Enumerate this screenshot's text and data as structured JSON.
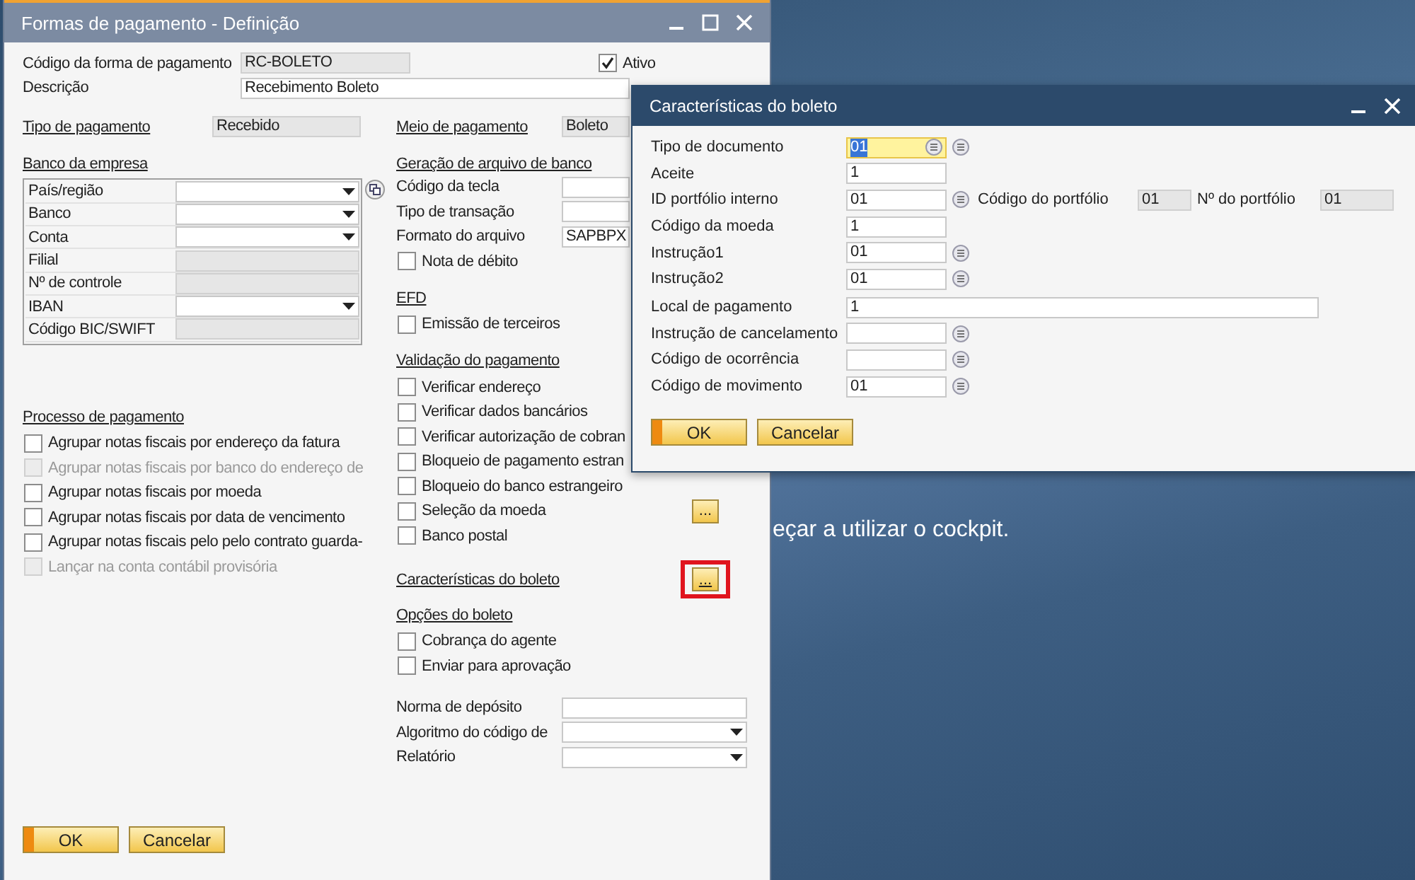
{
  "desktop": {
    "message": "eçar a utilizar o cockpit."
  },
  "main_window": {
    "title": "Formas de pagamento - Definição",
    "code": {
      "label": "Código da forma de pagamento",
      "value": "RC-BOLETO"
    },
    "active": {
      "label": "Ativo",
      "checked": true
    },
    "description": {
      "label": "Descrição",
      "value": "Recebimento Boleto"
    },
    "left": [
      {
        "kind": "readonly",
        "label": "Tipo de pagamento",
        "value": "Recebido",
        "linked": true
      },
      {
        "kind": "title",
        "text": "Banco da empresa"
      },
      {
        "kind": "table",
        "rows": [
          {
            "label": "País/região",
            "kind": "dropdown"
          },
          {
            "label": "Banco",
            "kind": "dropdown"
          },
          {
            "label": "Conta",
            "kind": "dropdown"
          },
          {
            "label": "Filial",
            "kind": "readonly"
          },
          {
            "label": "Nº de controle",
            "kind": "readonly"
          },
          {
            "label": "IBAN",
            "kind": "dropdown"
          },
          {
            "label": "Código BIC/SWIFT",
            "kind": "readonly"
          }
        ]
      },
      {
        "kind": "title",
        "text": "Processo de pagamento"
      },
      {
        "kind": "checkbox",
        "label": "Agrupar notas fiscais por endereço da fatura",
        "checked": false,
        "disabled": false
      },
      {
        "kind": "checkbox",
        "label": "Agrupar notas fiscais por banco do endereço de",
        "checked": false,
        "disabled": true
      },
      {
        "kind": "checkbox",
        "label": "Agrupar notas fiscais por moeda",
        "checked": false,
        "disabled": false
      },
      {
        "kind": "checkbox",
        "label": "Agrupar notas fiscais por data de vencimento",
        "checked": false,
        "disabled": false
      },
      {
        "kind": "checkbox",
        "label": "Agrupar notas fiscais pelo pelo contrato guarda-",
        "checked": false,
        "disabled": false
      },
      {
        "kind": "checkbox",
        "label": "Lançar na conta contábil provisória",
        "checked": false,
        "disabled": true
      }
    ],
    "right": [
      {
        "kind": "readonly",
        "label": "Meio de pagamento",
        "value": "Boleto",
        "linked": true
      },
      {
        "kind": "title",
        "text": "Geração de arquivo de banco"
      },
      {
        "kind": "input",
        "label": "Código da tecla",
        "linked": false
      },
      {
        "kind": "input",
        "label": "Tipo de transação",
        "linked": false
      },
      {
        "kind": "input",
        "label": "Formato do arquivo",
        "value": "SAPBPX",
        "linked": false
      },
      {
        "kind": "checkbox",
        "label": "Nota de débito",
        "checked": false,
        "disabled": false
      },
      {
        "kind": "title",
        "text": "EFD"
      },
      {
        "kind": "checkbox",
        "label": "Emissão de terceiros",
        "checked": false,
        "disabled": false
      },
      {
        "kind": "title",
        "text": "Validação do pagamento"
      },
      {
        "kind": "checkbox",
        "label": "Verificar endereço",
        "checked": false,
        "disabled": false
      },
      {
        "kind": "checkbox",
        "label": "Verificar dados bancários",
        "checked": false,
        "disabled": false
      },
      {
        "kind": "checkbox",
        "label": "Verificar autorização de cobran",
        "checked": false,
        "disabled": false
      },
      {
        "kind": "checkbox",
        "label": "Bloqueio de pagamento estran",
        "checked": false,
        "disabled": false
      },
      {
        "kind": "checkbox",
        "label": "Bloqueio do banco estrangeiro",
        "checked": false,
        "disabled": false
      },
      {
        "kind": "checkbox",
        "label": "Seleção da moeda",
        "checked": false,
        "disabled": false,
        "button": {
          "label": "...",
          "highlighted": false
        }
      },
      {
        "kind": "checkbox",
        "label": "Banco postal",
        "checked": false,
        "disabled": false
      },
      {
        "kind": "title",
        "text": "Características do boleto",
        "button": {
          "label": "...",
          "highlighted": true
        }
      },
      {
        "kind": "title",
        "text": "Opções do boleto"
      },
      {
        "kind": "checkbox",
        "label": "Cobrança do agente",
        "checked": false,
        "disabled": false
      },
      {
        "kind": "checkbox",
        "label": "Enviar para aprovação",
        "checked": false,
        "disabled": false
      },
      {
        "kind": "input",
        "label": "Norma de depósito",
        "linked": false
      },
      {
        "kind": "dropdown",
        "label": "Algoritmo do código de",
        "linked": false
      },
      {
        "kind": "dropdown",
        "label": "Relatório",
        "linked": false
      }
    ],
    "buttons": [
      {
        "label": "OK",
        "default": true
      },
      {
        "label": "Cancelar",
        "default": false
      }
    ]
  },
  "dialog": {
    "title": "Características do boleto",
    "rows": [
      {
        "label": "Tipo de documento",
        "value": "01",
        "kind": "short",
        "focused": true,
        "lookup": true
      },
      {
        "label": "Aceite",
        "value": "1",
        "kind": "short",
        "focused": false,
        "lookup": false
      },
      {
        "label": "ID portfólio interno",
        "value": "01",
        "kind": "short",
        "focused": false,
        "lookup": true,
        "extras": [
          {
            "label": "Código do portfólio",
            "value": "01"
          },
          {
            "label": "Nº do portfólio",
            "value": "01"
          }
        ]
      },
      {
        "label": "Código da moeda",
        "value": "1",
        "kind": "short",
        "focused": false,
        "lookup": false
      },
      {
        "label": "Instrução1",
        "value": "01",
        "kind": "short",
        "focused": false,
        "lookup": true
      },
      {
        "label": "Instrução2",
        "value": "01",
        "kind": "short",
        "focused": false,
        "lookup": true
      },
      {
        "label": "Local de pagamento",
        "value": "1",
        "kind": "long",
        "focused": false,
        "lookup": false
      },
      {
        "label": "Instrução de cancelamento",
        "kind": "short",
        "focused": false,
        "lookup": true
      },
      {
        "label": "Código de ocorrência",
        "kind": "short",
        "focused": false,
        "lookup": true
      },
      {
        "label": "Código de movimento",
        "value": "01",
        "kind": "short",
        "focused": false,
        "lookup": true
      }
    ],
    "buttons": [
      {
        "label": "OK",
        "default": true
      },
      {
        "label": "Cancelar",
        "default": false
      }
    ]
  }
}
